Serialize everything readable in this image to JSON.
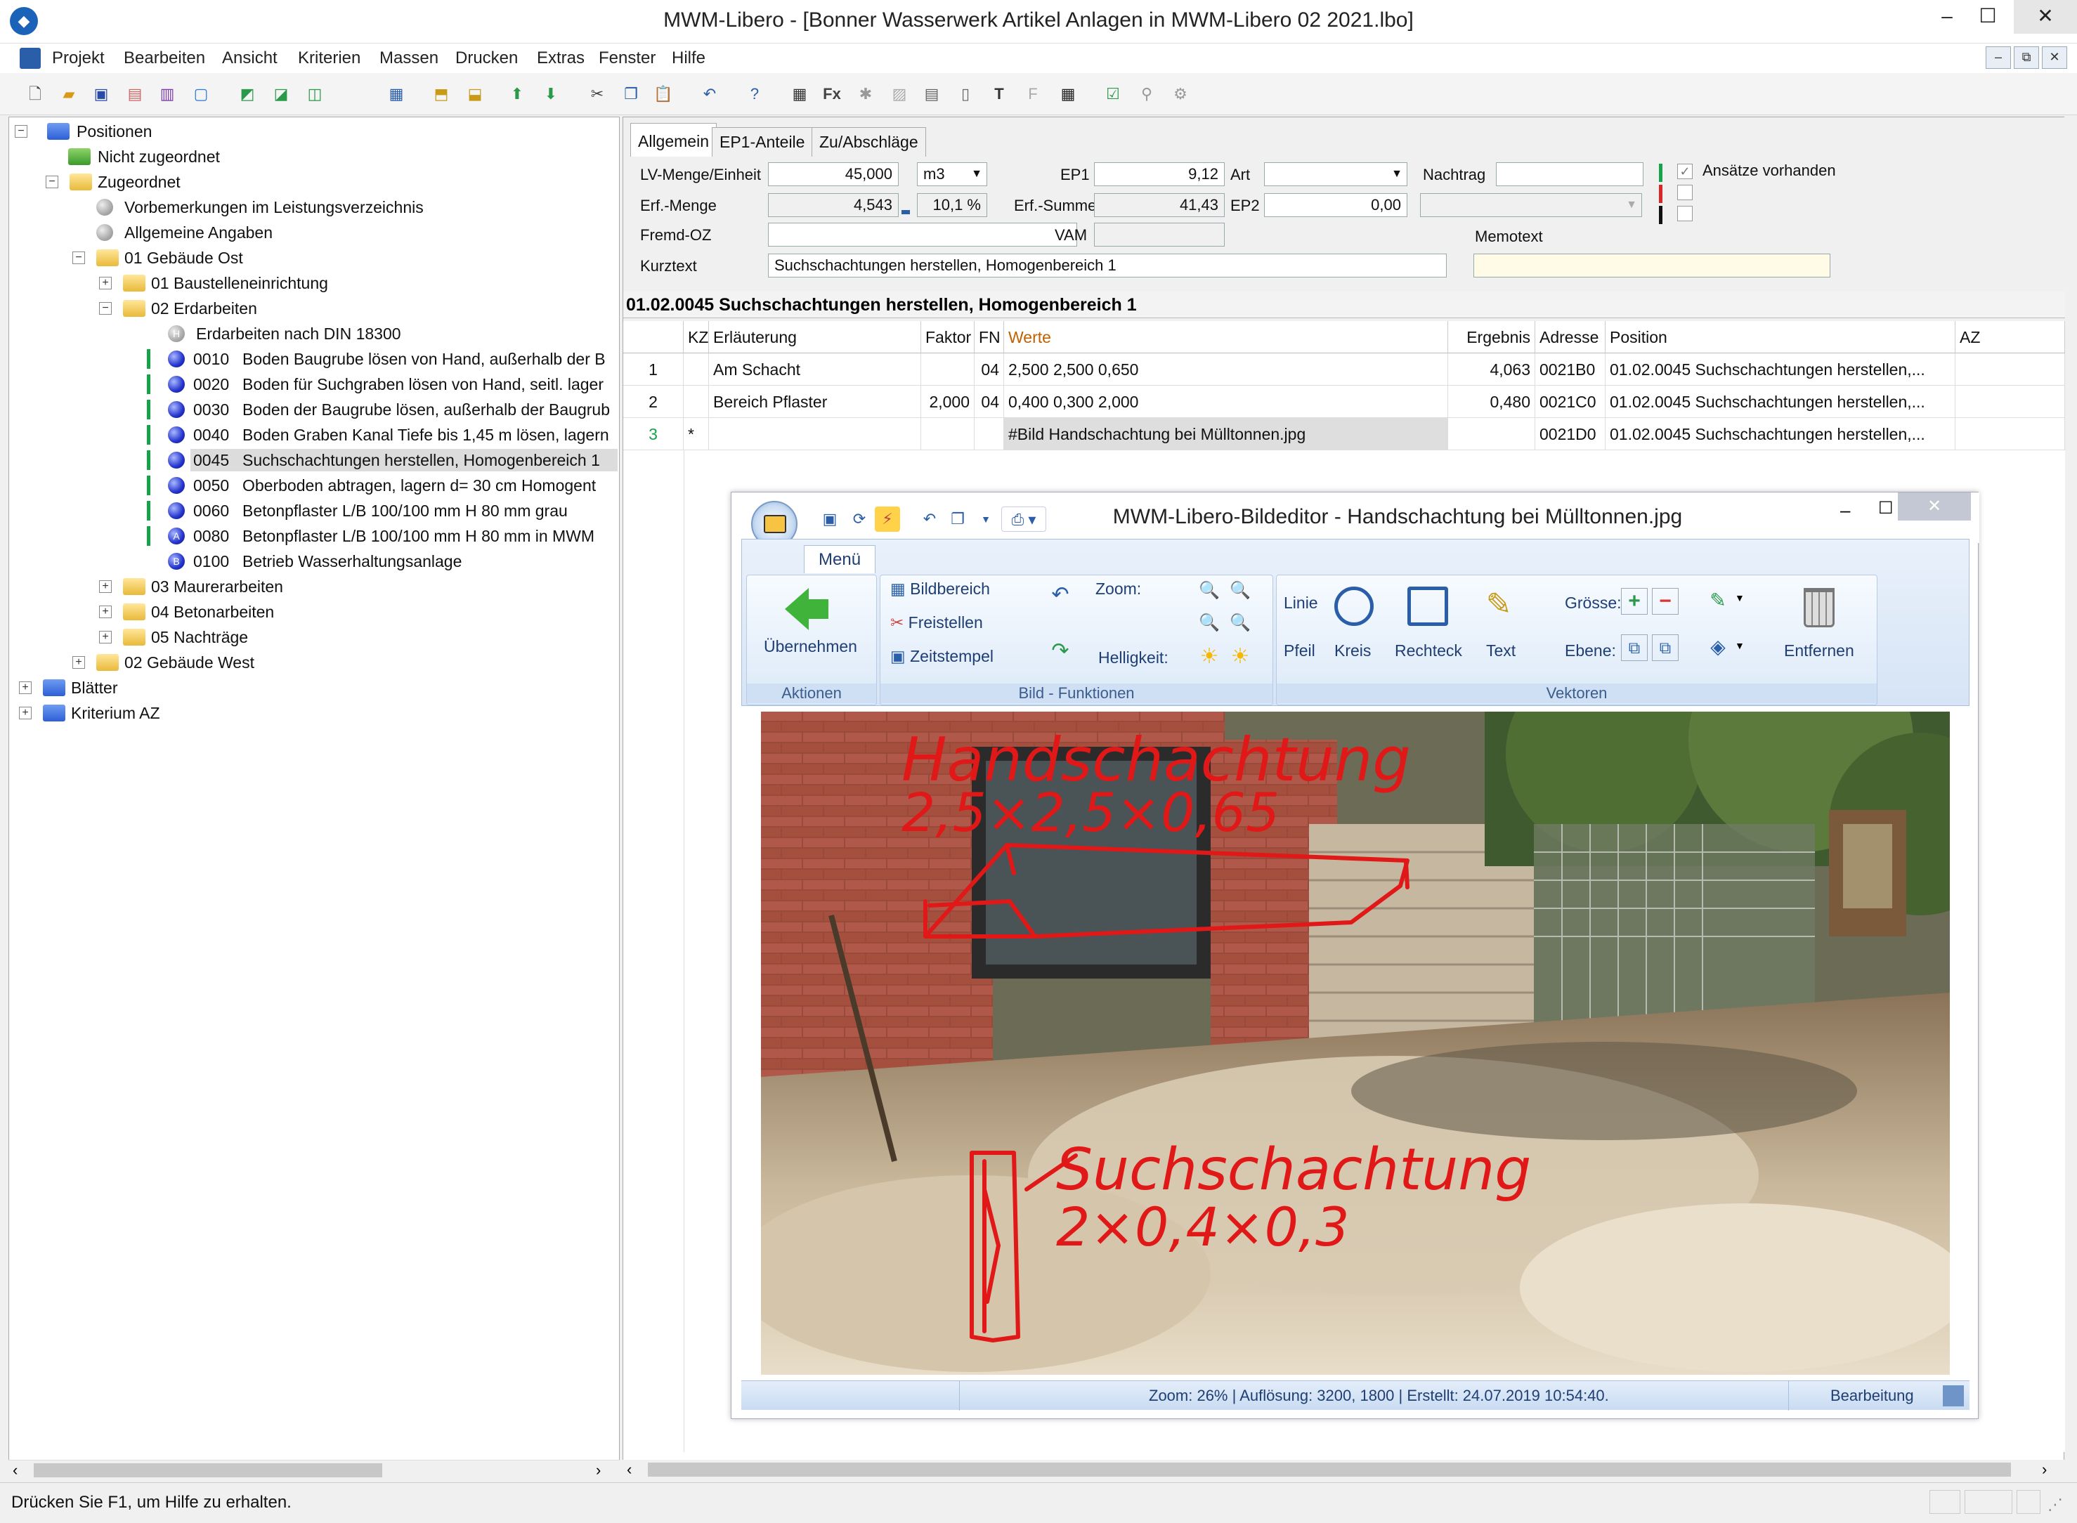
{
  "window": {
    "title": "MWM-Libero - [Bonner Wasserwerk Artikel Anlagen in MWM-Libero 02 2021.lbo]",
    "controls": {
      "minimize": "–",
      "maximize": "☐",
      "close": "✕"
    },
    "mdi": {
      "minimize": "–",
      "restore": "⧉",
      "close": "✕"
    }
  },
  "menu": [
    "Projekt",
    "Bearbeiten",
    "Ansicht",
    "Kriterien",
    "Massen",
    "Drucken",
    "Extras",
    "Fenster",
    "Hilfe"
  ],
  "toolbar": {
    "fx_label": "Fx",
    "text_label": "T",
    "sub_label": "F"
  },
  "tree": {
    "root": "Positionen",
    "nicht_zugeordnet": "Nicht zugeordnet",
    "zugeordnet": "Zugeordnet",
    "vorbemerkungen": "Vorbemerkungen im Leistungsverzeichnis",
    "allgemeine": "Allgemeine Angaben",
    "gebaeude_ost": "01 Gebäude Ost",
    "baustelle": "01 Baustelleneinrichtung",
    "erdarbeiten": "02 Erdarbeiten",
    "erd_din": "Erdarbeiten nach DIN 18300",
    "items": [
      {
        "code": "0010",
        "text": "Boden Baugrube lösen von Hand, außerhalb der B"
      },
      {
        "code": "0020",
        "text": "Boden für Suchgraben lösen von Hand, seitl. lager"
      },
      {
        "code": "0030",
        "text": "Boden der Baugrube lösen, außerhalb der Baugrub"
      },
      {
        "code": "0040",
        "text": "Boden Graben Kanal Tiefe bis 1,45 m lösen, lagern"
      },
      {
        "code": "0045",
        "text": "Suchschachtungen herstellen, Homogenbereich 1"
      },
      {
        "code": "0050",
        "text": "Oberboden abtragen, lagern d= 30 cm Homogent"
      },
      {
        "code": "0060",
        "text": "Betonpflaster L/B 100/100 mm H 80 mm  grau"
      },
      {
        "code": "0080",
        "text": "Betonpflaster L/B 100/100 mm H 80 mm  in MWM"
      },
      {
        "code": "0100",
        "text": "Betrieb Wasserhaltungsanlage"
      }
    ],
    "maurer": "03 Maurerarbeiten",
    "beton": "04 Betonarbeiten",
    "nachtraege": "05 Nachträge",
    "gebaeude_west": "02 Gebäude West",
    "blaetter": "Blätter",
    "kriterium": "Kriterium AZ",
    "badge_h": "H",
    "badge_a": "A",
    "badge_b": "B"
  },
  "tabs": [
    "Allgemein",
    "EP1-Anteile",
    "Zu/Abschläge"
  ],
  "form": {
    "lv_menge_label": "LV-Menge/Einheit",
    "lv_menge": "45,000",
    "einheit": "m3",
    "ep1_label": "EP1",
    "ep1": "9,12",
    "art_label": "Art",
    "art": "",
    "nachtrag_label": "Nachtrag",
    "nachtrag": "",
    "ansaetze_label": "Ansätze vorhanden",
    "erf_menge_label": "Erf.-Menge",
    "erf_menge": "4,543",
    "prozent": "10,1 %",
    "erf_summe_label": "Erf.-Summe",
    "erf_summe": "41,43",
    "ep2_label": "EP2",
    "ep2": "0,00",
    "fremd_oz_label": "Fremd-OZ",
    "fremd_oz": "",
    "vam_label": "VAM",
    "vam": "",
    "memotext_label": "Memotext",
    "memotext": "",
    "kurztext_label": "Kurztext",
    "kurztext": "Suchschachtungen herstellen, Homogenbereich 1"
  },
  "section_title": "01.02.0045  Suchschachtungen herstellen, Homogenbereich 1",
  "grid": {
    "headers": [
      "KZ",
      "Erläuterung",
      "Faktor",
      "FN",
      "Werte",
      "Ergebnis",
      "Adresse",
      "Position",
      "AZ"
    ],
    "rows": [
      {
        "no": "1",
        "kz": "",
        "erl": "Am Schacht",
        "faktor": "",
        "fn": "04",
        "werte": "2,500 2,500 0,650",
        "ergebnis": "4,063",
        "adresse": "0021B0",
        "position": "01.02.0045   Suchschachtungen herstellen,...",
        "az": ""
      },
      {
        "no": "2",
        "kz": "",
        "erl": "Bereich Pflaster",
        "faktor": "2,000",
        "fn": "04",
        "werte": "0,400 0,300 2,000",
        "ergebnis": "0,480",
        "adresse": "0021C0",
        "position": "01.02.0045   Suchschachtungen herstellen,...",
        "az": ""
      },
      {
        "no": "3",
        "kz": "*",
        "erl": "",
        "faktor": "",
        "fn": "",
        "werte": "#Bild Handschachtung bei Mülltonnen.jpg",
        "ergebnis": "",
        "adresse": "0021D0",
        "position": "01.02.0045   Suchschachtungen herstellen,...",
        "az": ""
      }
    ]
  },
  "editor": {
    "title": "MWM-Libero-Bildeditor - Handschachtung bei Mülltonnen.jpg",
    "menu_tab": "Menü",
    "uebernehmen": "Übernehmen",
    "aktionen": "Aktionen",
    "bildbereich": "Bildbereich",
    "freistellen": "Freistellen",
    "zeitstempel": "Zeitstempel",
    "zoom": "Zoom:",
    "helligkeit": "Helligkeit:",
    "bild_funktionen": "Bild - Funktionen",
    "linie": "Linie",
    "pfeil": "Pfeil",
    "kreis": "Kreis",
    "rechteck": "Rechteck",
    "text": "Text",
    "groesse": "Grösse:",
    "ebene": "Ebene:",
    "entfernen": "Entfernen",
    "vektoren": "Vektoren",
    "annotation1_line1": "Handschachtung",
    "annotation1_line2": "2,5×2,5×0,65",
    "annotation2_line1": "Suchschachtung",
    "annotation2_line2": "2×0,4×0,3",
    "status": "Zoom: 26%  |  Auflösung: 3200, 1800  |  Erstellt: 24.07.2019 10:54:40.",
    "mode": "Bearbeitung"
  },
  "statusbar": "Drücken Sie F1, um Hilfe zu erhalten."
}
